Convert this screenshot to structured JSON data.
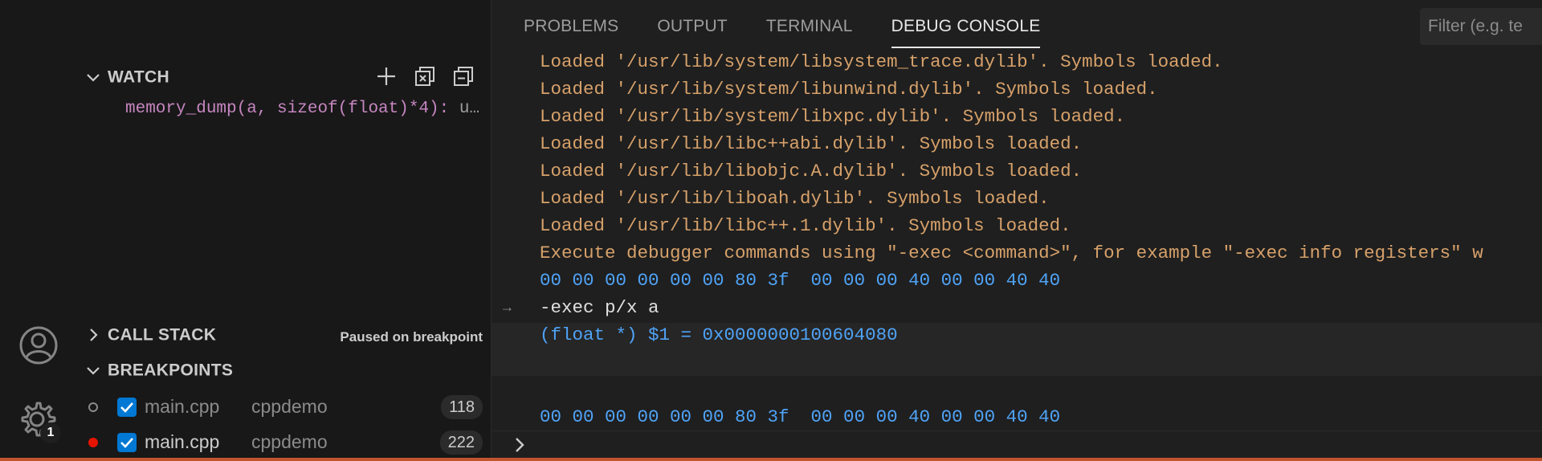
{
  "sidebar": {
    "watch": {
      "title": "WATCH",
      "expression": "memory_dump(a, sizeof(float)*4): ",
      "value_preview": "u…"
    },
    "call_stack": {
      "title": "CALL STACK",
      "status": "Paused on breakpoint"
    },
    "breakpoints": {
      "title": "BREAKPOINTS",
      "items": [
        {
          "file": "main.cpp",
          "project": "cppdemo",
          "line": "118",
          "enabled": true,
          "verified": false
        },
        {
          "file": "main.cpp",
          "project": "cppdemo",
          "line": "222",
          "enabled": true,
          "verified": true
        }
      ]
    }
  },
  "activity_bar": {
    "settings_badge": "1"
  },
  "panel": {
    "tabs": [
      {
        "label": "PROBLEMS",
        "active": false
      },
      {
        "label": "OUTPUT",
        "active": false
      },
      {
        "label": "TERMINAL",
        "active": false
      },
      {
        "label": "DEBUG CONSOLE",
        "active": true
      }
    ],
    "filter_placeholder": "Filter (e.g. te",
    "console_lines": [
      "Loaded '/usr/lib/system/libsystem_trace.dylib'. Symbols loaded.",
      "Loaded '/usr/lib/system/libunwind.dylib'. Symbols loaded.",
      "Loaded '/usr/lib/system/libxpc.dylib'. Symbols loaded.",
      "Loaded '/usr/lib/libc++abi.dylib'. Symbols loaded.",
      "Loaded '/usr/lib/libobjc.A.dylib'. Symbols loaded.",
      "Loaded '/usr/lib/liboah.dylib'. Symbols loaded.",
      "Loaded '/usr/lib/libc++.1.dylib'. Symbols loaded.",
      "Execute debugger commands using \"-exec <command>\", for example \"-exec info registers\" w"
    ],
    "memory_line_1": "00 00 00 00 00 00 80 3f  00 00 00 40 00 00 40 40",
    "command": "-exec p/x a",
    "result": "(float *) $1 = 0x0000000100604080",
    "memory_line_2": "00 00 00 00 00 00 80 3f  00 00 00 40 00 00 40 40"
  },
  "colors": {
    "log_text": "#d7a16a",
    "memory_text": "#4fa3f7",
    "accent": "#0078d4",
    "status_bar": "#c2542d",
    "breakpoint_red": "#e51400"
  }
}
